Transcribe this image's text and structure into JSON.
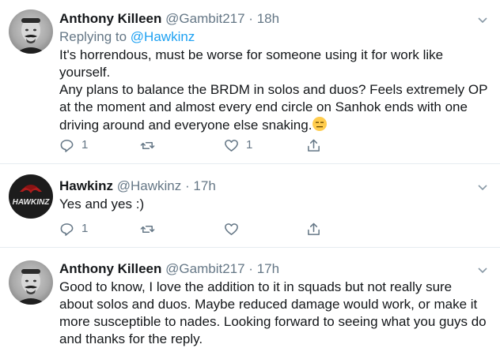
{
  "tweets": [
    {
      "name": "Anthony Killeen",
      "handle": "@Gambit217",
      "separator": "·",
      "time": "18h",
      "reply_prefix": "Replying to",
      "reply_to": "@Hawkinz",
      "lines": [
        "It's horrendous, must be worse for someone using it for work like",
        "yourself.",
        "Any plans to balance the BRDM in solos and duos? Feels extremely OP",
        "at the moment and almost every end circle on Sanhok ends with one",
        "driving around and everyone else snaking."
      ],
      "emoji": "expressionless-face-icon",
      "reply_count": "1",
      "retweet_count": "",
      "like_count": "1"
    },
    {
      "name": "Hawkinz",
      "handle": "@Hawkinz",
      "separator": "·",
      "time": "17h",
      "lines": [
        "Yes and yes :)"
      ],
      "avatar_text": "HAWKINZ",
      "reply_count": "1",
      "retweet_count": "",
      "like_count": ""
    },
    {
      "name": "Anthony Killeen",
      "handle": "@Gambit217",
      "separator": "·",
      "time": "17h",
      "lines": [
        "Good to know, I love the addition to it in squads but not really sure",
        "about solos and duos. Maybe reduced damage would work, or make it",
        "more susceptible to nades. Looking forward to seeing what you guys do",
        "and thanks for the reply."
      ]
    }
  ],
  "colors": {
    "text": "#14171a",
    "muted": "#657786",
    "link": "#1da1f2",
    "divider": "#e6ecf0"
  }
}
